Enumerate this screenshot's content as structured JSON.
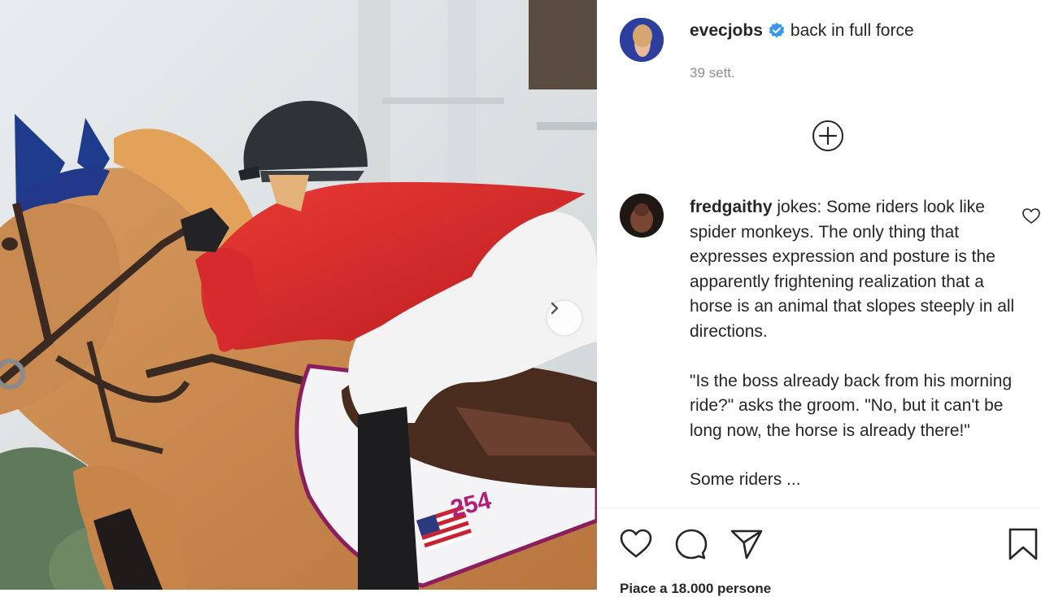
{
  "post": {
    "username": "evecjobs",
    "caption": "back in full force",
    "time": "39 sett."
  },
  "comment": {
    "username": "fredgaithy",
    "paragraph1": "jokes: Some riders look like spider monkeys. The only thing that expresses expression and posture is the apparently frightening realization that a horse is an animal that slopes steeply in all directions.",
    "paragraph2": "\"Is the boss already back from his morning ride?\" asks the groom. \"No, but it can't be long now, the horse is already there!\"",
    "paragraph3": "Some riders ...",
    "likes": "Piace a 18.000 persone"
  },
  "photo": {
    "saddle_pad_number": "254"
  },
  "icons": {
    "verified": "verified-badge-icon",
    "next": "chevron-right-icon",
    "add": "plus-circle-icon",
    "like": "heart-icon",
    "comment": "comment-bubble-icon",
    "share": "paper-plane-icon",
    "save": "bookmark-icon"
  },
  "colors": {
    "verified_blue": "#3897f0",
    "jacket_red": "#d9262c",
    "horse_chestnut": "#c98a52",
    "ear_bonnet_blue": "#1e3b8c"
  }
}
